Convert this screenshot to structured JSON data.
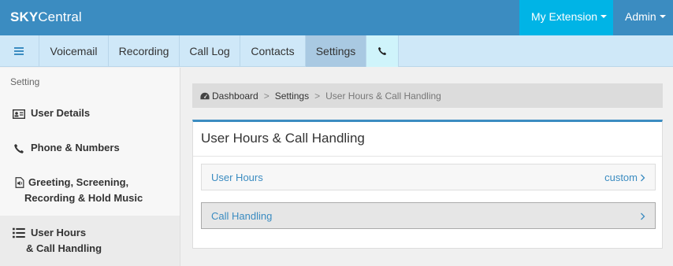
{
  "header": {
    "brand_bold": "SKY",
    "brand_light": "Central",
    "extension_label": "My Extension",
    "admin_label": "Admin"
  },
  "nav": {
    "items": [
      "Voicemail",
      "Recording",
      "Call Log",
      "Contacts",
      "Settings"
    ],
    "active": "Settings"
  },
  "sidebar": {
    "heading": "Setting",
    "items": [
      {
        "label": "User Details",
        "icon": "id-card-icon"
      },
      {
        "label": "Phone & Numbers",
        "icon": "phone-icon"
      },
      {
        "label_line1": "Greeting, Screening,",
        "label_line2": "Recording & Hold Music",
        "icon": "audio-file-icon"
      },
      {
        "label_line1": "User Hours",
        "label_line2": "& Call Handling",
        "icon": "list-icon",
        "active": true
      }
    ]
  },
  "breadcrumb": {
    "dashboard": "Dashboard",
    "settings": "Settings",
    "current": "User Hours & Call Handling",
    "separator": ">"
  },
  "panel": {
    "title": "User Hours & Call Handling",
    "rows": [
      {
        "label": "User Hours",
        "value": "custom"
      },
      {
        "label": "Call Handling",
        "value": ""
      }
    ]
  },
  "colors": {
    "topbar": "#3b8cc1",
    "extension_button": "#00b4e6",
    "navbar": "#cfe8f8",
    "link": "#3b8cc1"
  }
}
